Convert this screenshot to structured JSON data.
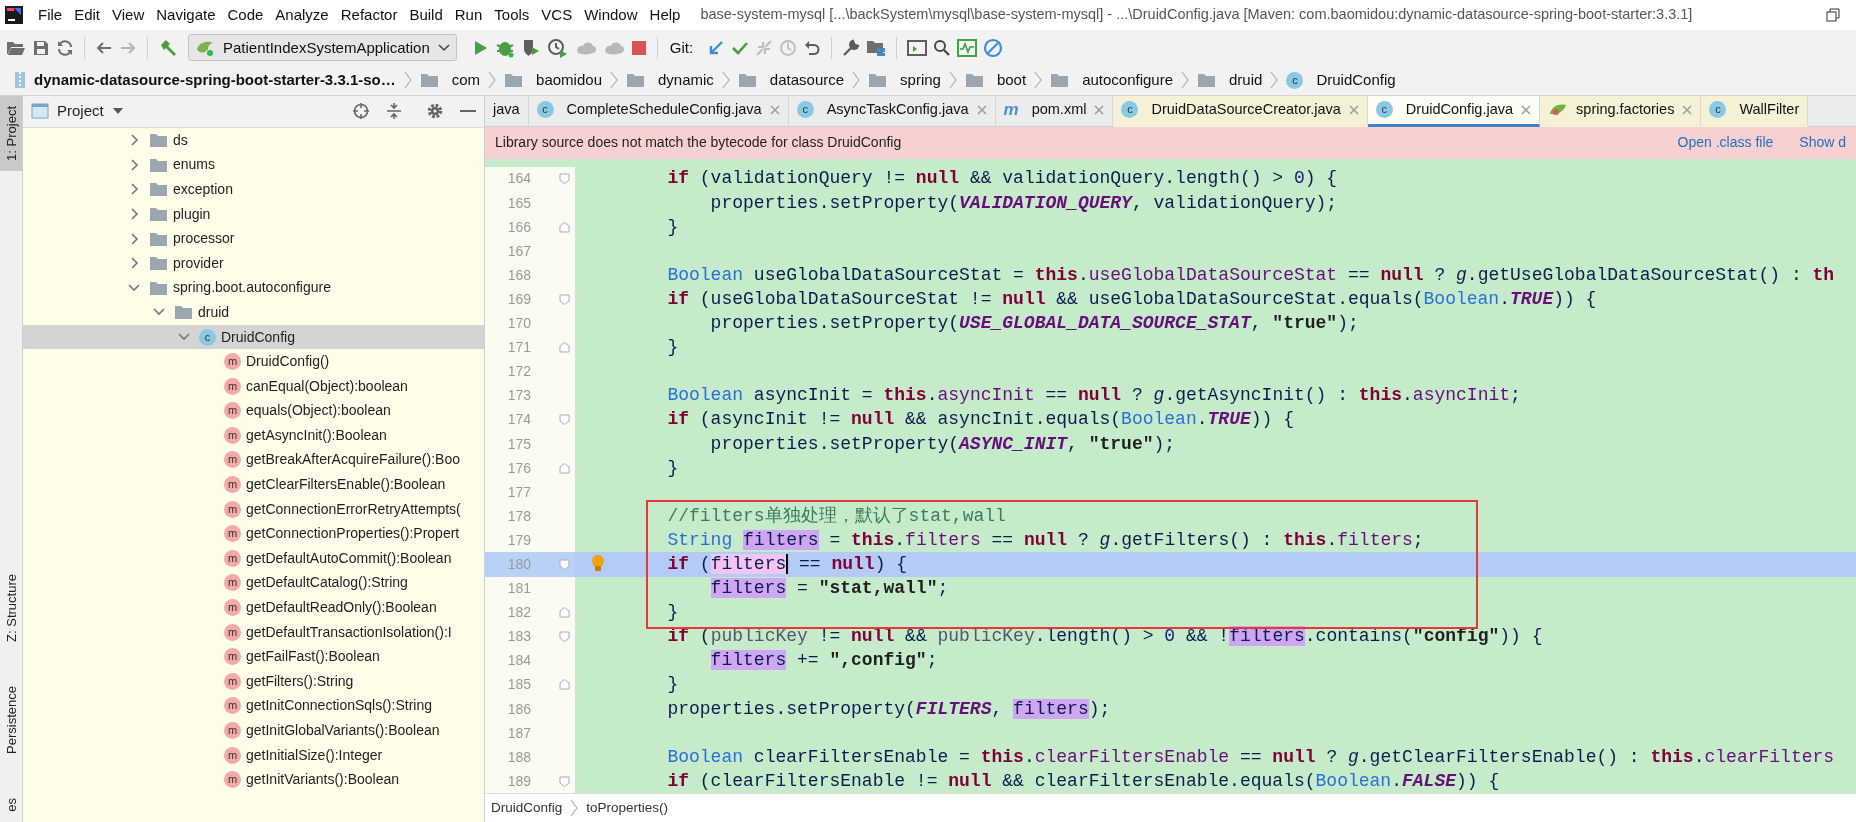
{
  "window": {
    "title": "base-system-mysql [...\\backSystem\\mysql\\base-system-mysql] - ...\\DruidConfig.java [Maven: com.baomidou:dynamic-datasource-spring-boot-starter:3.3.1]"
  },
  "menu": [
    "File",
    "Edit",
    "View",
    "Navigate",
    "Code",
    "Analyze",
    "Refactor",
    "Build",
    "Run",
    "Tools",
    "VCS",
    "Window",
    "Help"
  ],
  "toolbar": {
    "run_configuration": "PatientIndexSystemApplication",
    "vcs_label": "Git:"
  },
  "nav_path": [
    {
      "kind": "module",
      "label": "dynamic-datasource-spring-boot-starter-3.3.1-so…"
    },
    {
      "kind": "folder",
      "label": "com"
    },
    {
      "kind": "folder",
      "label": "baomidou"
    },
    {
      "kind": "folder",
      "label": "dynamic"
    },
    {
      "kind": "folder",
      "label": "datasource"
    },
    {
      "kind": "folder",
      "label": "spring"
    },
    {
      "kind": "folder",
      "label": "boot"
    },
    {
      "kind": "folder",
      "label": "autoconfigure"
    },
    {
      "kind": "folder",
      "label": "druid"
    },
    {
      "kind": "class",
      "label": "DruidConfig",
      "icon_text": "c"
    }
  ],
  "tool_stripe": {
    "top": [
      {
        "label": "1: Project",
        "selected": true
      }
    ],
    "bottom": [
      {
        "label": "Z: Structure",
        "selected": false
      },
      {
        "label": "Persistence",
        "selected": false
      },
      {
        "label": "es",
        "selected": false
      }
    ]
  },
  "project": {
    "title": "Project",
    "tree": [
      {
        "label": "ds",
        "kind": "folder",
        "expanded": false,
        "selected": false
      },
      {
        "label": "enums",
        "kind": "folder",
        "expanded": false,
        "selected": false
      },
      {
        "label": "exception",
        "kind": "folder",
        "expanded": false,
        "selected": false
      },
      {
        "label": "plugin",
        "kind": "folder",
        "expanded": false,
        "selected": false
      },
      {
        "label": "processor",
        "kind": "folder",
        "expanded": false,
        "selected": false
      },
      {
        "label": "provider",
        "kind": "folder",
        "expanded": false,
        "selected": false
      },
      {
        "label": "spring.boot.autoconfigure",
        "kind": "folder",
        "expanded": true,
        "selected": false,
        "children": [
          {
            "label": "druid",
            "kind": "folder",
            "expanded": true,
            "selected": false,
            "children": [
              {
                "label": "DruidConfig",
                "kind": "class",
                "icon_text": "c",
                "expanded": true,
                "selected": true,
                "children": [
                  {
                    "label": "DruidConfig()",
                    "kind": "method",
                    "icon_text": "m",
                    "selected": false
                  },
                  {
                    "label": "canEqual(Object):boolean",
                    "kind": "method",
                    "icon_text": "m",
                    "selected": false
                  },
                  {
                    "label": "equals(Object):boolean",
                    "kind": "method",
                    "icon_text": "m",
                    "selected": false
                  },
                  {
                    "label": "getAsyncInit():Boolean",
                    "kind": "method",
                    "icon_text": "m",
                    "selected": false
                  },
                  {
                    "label": "getBreakAfterAcquireFailure():Boo",
                    "kind": "method",
                    "icon_text": "m",
                    "selected": false
                  },
                  {
                    "label": "getClearFiltersEnable():Boolean",
                    "kind": "method",
                    "icon_text": "m",
                    "selected": false
                  },
                  {
                    "label": "getConnectionErrorRetryAttempts(",
                    "kind": "method",
                    "icon_text": "m",
                    "selected": false
                  },
                  {
                    "label": "getConnectionProperties():Propert",
                    "kind": "method",
                    "icon_text": "m",
                    "selected": false
                  },
                  {
                    "label": "getDefaultAutoCommit():Boolean",
                    "kind": "method",
                    "icon_text": "m",
                    "selected": false
                  },
                  {
                    "label": "getDefaultCatalog():String",
                    "kind": "method",
                    "icon_text": "m",
                    "selected": false
                  },
                  {
                    "label": "getDefaultReadOnly():Boolean",
                    "kind": "method",
                    "icon_text": "m",
                    "selected": false
                  },
                  {
                    "label": "getDefaultTransactionIsolation():I",
                    "kind": "method",
                    "icon_text": "m",
                    "selected": false
                  },
                  {
                    "label": "getFailFast():Boolean",
                    "kind": "method",
                    "icon_text": "m",
                    "selected": false
                  },
                  {
                    "label": "getFilters():String",
                    "kind": "method",
                    "icon_text": "m",
                    "selected": false
                  },
                  {
                    "label": "getInitConnectionSqls():String",
                    "kind": "method",
                    "icon_text": "m",
                    "selected": false
                  },
                  {
                    "label": "getInitGlobalVariants():Boolean",
                    "kind": "method",
                    "icon_text": "m",
                    "selected": false
                  },
                  {
                    "label": "getInitialSize():Integer",
                    "kind": "method",
                    "icon_text": "m",
                    "selected": false
                  },
                  {
                    "label": "getInitVariants():Boolean",
                    "kind": "method",
                    "icon_text": "m",
                    "selected": false
                  }
                ]
              }
            ]
          }
        ]
      }
    ]
  },
  "tabs": [
    {
      "label": "java",
      "kind": "cut",
      "selected": false,
      "library": false,
      "closable": false
    },
    {
      "label": "CompleteScheduleConfig.java",
      "kind": "class",
      "icon_text": "c",
      "selected": false,
      "library": false,
      "closable": true
    },
    {
      "label": "AsyncTaskConfig.java",
      "kind": "class",
      "icon_text": "c",
      "selected": false,
      "library": false,
      "closable": true
    },
    {
      "label": "pom.xml",
      "kind": "maven",
      "icon_text": "m",
      "selected": false,
      "library": false,
      "closable": true
    },
    {
      "label": "DruidDataSourceCreator.java",
      "kind": "class",
      "icon_text": "c",
      "selected": false,
      "library": true,
      "closable": true
    },
    {
      "label": "DruidConfig.java",
      "kind": "class",
      "icon_text": "c",
      "selected": true,
      "library": true,
      "closable": true
    },
    {
      "label": "spring.factories",
      "kind": "spring",
      "selected": false,
      "library": true,
      "closable": true
    },
    {
      "label": "WallFilter",
      "kind": "class",
      "icon_text": "c",
      "selected": false,
      "library": true,
      "closable": false
    }
  ],
  "banner": {
    "message": "Library source does not match the bytecode for class DruidConfig",
    "actions": [
      "Open .class file",
      "Show d"
    ]
  },
  "code": {
    "lines": [
      {
        "number": "164",
        "fold_start": true,
        "tokens": [
          {
            "kind": "kw",
            "text": "        if"
          },
          {
            "kind": "plain",
            "text": " (validationQuery != "
          },
          {
            "kind": "kw",
            "text": "null"
          },
          {
            "kind": "plain",
            "text": " && validationQuery.length() > "
          },
          {
            "kind": "num",
            "text": "0"
          },
          {
            "kind": "plain",
            "text": ") {"
          }
        ]
      },
      {
        "number": "165",
        "tokens": [
          {
            "kind": "plain",
            "text": "            properties.setProperty("
          },
          {
            "kind": "const",
            "text": "VALIDATION_QUERY"
          },
          {
            "kind": "plain",
            "text": ", validationQuery);"
          }
        ]
      },
      {
        "number": "166",
        "fold_end": true,
        "tokens": [
          {
            "kind": "plain",
            "text": "        }"
          }
        ]
      },
      {
        "number": "167"
      },
      {
        "number": "168",
        "tokens": [
          {
            "kind": "type",
            "text": "        Boolean"
          },
          {
            "kind": "plain",
            "text": " useGlobalDataSourceStat = "
          },
          {
            "kind": "kw",
            "text": "this"
          },
          {
            "kind": "plain",
            "text": "."
          },
          {
            "kind": "field",
            "text": "useGlobalDataSourceStat"
          },
          {
            "kind": "plain",
            "text": " == "
          },
          {
            "kind": "kw",
            "text": "null"
          },
          {
            "kind": "plain",
            "text": " ? "
          },
          {
            "kind": "static",
            "text": "g"
          },
          {
            "kind": "plain",
            "text": ".getUseGlobalDataSourceStat() : "
          },
          {
            "kind": "kw",
            "text": "th"
          }
        ]
      },
      {
        "number": "169",
        "fold_start": true,
        "tokens": [
          {
            "kind": "kw",
            "text": "        if"
          },
          {
            "kind": "plain",
            "text": " (useGlobalDataSourceStat != "
          },
          {
            "kind": "kw",
            "text": "null"
          },
          {
            "kind": "plain",
            "text": " && useGlobalDataSourceStat.equals("
          },
          {
            "kind": "type",
            "text": "Boolean"
          },
          {
            "kind": "plain",
            "text": "."
          },
          {
            "kind": "const",
            "text": "TRUE"
          },
          {
            "kind": "plain",
            "text": ")) {"
          }
        ]
      },
      {
        "number": "170",
        "tokens": [
          {
            "kind": "plain",
            "text": "            properties.setProperty("
          },
          {
            "kind": "const",
            "text": "USE_GLOBAL_DATA_SOURCE_STAT"
          },
          {
            "kind": "plain",
            "text": ", "
          },
          {
            "kind": "str",
            "text": "\"true\""
          },
          {
            "kind": "plain",
            "text": ");"
          }
        ]
      },
      {
        "number": "171",
        "fold_end": true,
        "tokens": [
          {
            "kind": "plain",
            "text": "        }"
          }
        ]
      },
      {
        "number": "172"
      },
      {
        "number": "173",
        "tokens": [
          {
            "kind": "type",
            "text": "        Boolean"
          },
          {
            "kind": "plain",
            "text": " asyncInit = "
          },
          {
            "kind": "kw",
            "text": "this"
          },
          {
            "kind": "plain",
            "text": "."
          },
          {
            "kind": "field",
            "text": "asyncInit"
          },
          {
            "kind": "plain",
            "text": " == "
          },
          {
            "kind": "kw",
            "text": "null"
          },
          {
            "kind": "plain",
            "text": " ? "
          },
          {
            "kind": "static",
            "text": "g"
          },
          {
            "kind": "plain",
            "text": ".getAsyncInit() : "
          },
          {
            "kind": "kw",
            "text": "this"
          },
          {
            "kind": "plain",
            "text": "."
          },
          {
            "kind": "field",
            "text": "asyncInit"
          },
          {
            "kind": "plain",
            "text": ";"
          }
        ]
      },
      {
        "number": "174",
        "fold_start": true,
        "tokens": [
          {
            "kind": "kw",
            "text": "        if"
          },
          {
            "kind": "plain",
            "text": " (asyncInit != "
          },
          {
            "kind": "kw",
            "text": "null"
          },
          {
            "kind": "plain",
            "text": " && asyncInit.equals("
          },
          {
            "kind": "type",
            "text": "Boolean"
          },
          {
            "kind": "plain",
            "text": "."
          },
          {
            "kind": "const",
            "text": "TRUE"
          },
          {
            "kind": "plain",
            "text": ")) {"
          }
        ]
      },
      {
        "number": "175",
        "tokens": [
          {
            "kind": "plain",
            "text": "            properties.setProperty("
          },
          {
            "kind": "const",
            "text": "ASYNC_INIT"
          },
          {
            "kind": "plain",
            "text": ", "
          },
          {
            "kind": "str",
            "text": "\"true\""
          },
          {
            "kind": "plain",
            "text": ");"
          }
        ]
      },
      {
        "number": "176",
        "fold_end": true,
        "tokens": [
          {
            "kind": "plain",
            "text": "        }"
          }
        ]
      },
      {
        "number": "177"
      },
      {
        "number": "178",
        "boxed": true,
        "tokens": [
          {
            "kind": "comment",
            "text": "        //filters单独处理，默认了stat,wall"
          }
        ]
      },
      {
        "number": "179",
        "boxed": true,
        "tokens": [
          {
            "kind": "type",
            "text": "        String "
          },
          {
            "kind": "usage",
            "text": "filters"
          },
          {
            "kind": "plain",
            "text": " = "
          },
          {
            "kind": "kw",
            "text": "this"
          },
          {
            "kind": "plain",
            "text": "."
          },
          {
            "kind": "field",
            "text": "filters"
          },
          {
            "kind": "plain",
            "text": " == "
          },
          {
            "kind": "kw",
            "text": "null"
          },
          {
            "kind": "plain",
            "text": " ? "
          },
          {
            "kind": "static",
            "text": "g"
          },
          {
            "kind": "plain",
            "text": ".getFilters() : "
          },
          {
            "kind": "kw",
            "text": "this"
          },
          {
            "kind": "plain",
            "text": "."
          },
          {
            "kind": "field",
            "text": "filters"
          },
          {
            "kind": "plain",
            "text": ";"
          }
        ]
      },
      {
        "number": "180",
        "fold_start": true,
        "boxed": true,
        "current": true,
        "bulb": true,
        "tokens": [
          {
            "kind": "kw",
            "text": "        if"
          },
          {
            "kind": "plain",
            "text": " ("
          },
          {
            "kind": "caret",
            "text": "filters"
          },
          {
            "kind": "plain",
            "text": " == "
          },
          {
            "kind": "kw",
            "text": "null"
          },
          {
            "kind": "plain",
            "text": ") {"
          }
        ]
      },
      {
        "number": "181",
        "boxed": true,
        "tokens": [
          {
            "kind": "usage",
            "text": "            filters"
          },
          {
            "kind": "plain",
            "text": " = "
          },
          {
            "kind": "str",
            "text": "\"stat,wall\""
          },
          {
            "kind": "plain",
            "text": ";"
          }
        ]
      },
      {
        "number": "182",
        "fold_end": true,
        "boxed": true,
        "tokens": [
          {
            "kind": "plain",
            "text": "        }"
          }
        ]
      },
      {
        "number": "183",
        "fold_start": true,
        "tokens": [
          {
            "kind": "kw",
            "text": "        if"
          },
          {
            "kind": "plain",
            "text": " ("
          },
          {
            "kind": "param",
            "text": "publicKey"
          },
          {
            "kind": "plain",
            "text": " != "
          },
          {
            "kind": "kw",
            "text": "null"
          },
          {
            "kind": "plain",
            "text": " && "
          },
          {
            "kind": "param",
            "text": "publicKey"
          },
          {
            "kind": "plain",
            "text": ".length() > "
          },
          {
            "kind": "num",
            "text": "0"
          },
          {
            "kind": "plain",
            "text": " && !"
          },
          {
            "kind": "usage",
            "text": "filters"
          },
          {
            "kind": "plain",
            "text": ".contains("
          },
          {
            "kind": "str",
            "text": "\"config\""
          },
          {
            "kind": "plain",
            "text": ")) {"
          }
        ]
      },
      {
        "number": "184",
        "tokens": [
          {
            "kind": "usage",
            "text": "            filters"
          },
          {
            "kind": "plain",
            "text": " += "
          },
          {
            "kind": "str",
            "text": "\",config\""
          },
          {
            "kind": "plain",
            "text": ";"
          }
        ]
      },
      {
        "number": "185",
        "fold_end": true,
        "tokens": [
          {
            "kind": "plain",
            "text": "        }"
          }
        ]
      },
      {
        "number": "186",
        "tokens": [
          {
            "kind": "plain",
            "text": "        properties.setProperty("
          },
          {
            "kind": "const",
            "text": "FILTERS"
          },
          {
            "kind": "plain",
            "text": ", "
          },
          {
            "kind": "usage",
            "text": "filters"
          },
          {
            "kind": "plain",
            "text": ");"
          }
        ]
      },
      {
        "number": "187"
      },
      {
        "number": "188",
        "tokens": [
          {
            "kind": "type",
            "text": "        Boolean"
          },
          {
            "kind": "plain",
            "text": " clearFiltersEnable = "
          },
          {
            "kind": "kw",
            "text": "this"
          },
          {
            "kind": "plain",
            "text": "."
          },
          {
            "kind": "field",
            "text": "clearFiltersEnable"
          },
          {
            "kind": "plain",
            "text": " == "
          },
          {
            "kind": "kw",
            "text": "null"
          },
          {
            "kind": "plain",
            "text": " ? "
          },
          {
            "kind": "static",
            "text": "g"
          },
          {
            "kind": "plain",
            "text": ".getClearFiltersEnable() : "
          },
          {
            "kind": "kw",
            "text": "this"
          },
          {
            "kind": "plain",
            "text": "."
          },
          {
            "kind": "field",
            "text": "clearFilters"
          }
        ]
      },
      {
        "number": "189",
        "fold_start": true,
        "tokens": [
          {
            "kind": "kw",
            "text": "        if"
          },
          {
            "kind": "plain",
            "text": " (clearFiltersEnable != "
          },
          {
            "kind": "kw",
            "text": "null"
          },
          {
            "kind": "plain",
            "text": " && clearFiltersEnable.equals("
          },
          {
            "kind": "type",
            "text": "Boolean"
          },
          {
            "kind": "plain",
            "text": "."
          },
          {
            "kind": "const",
            "text": "FALSE"
          },
          {
            "kind": "plain",
            "text": ")) {"
          }
        ]
      }
    ]
  },
  "editor_breadcrumb": [
    "DruidConfig",
    "toProperties()"
  ]
}
